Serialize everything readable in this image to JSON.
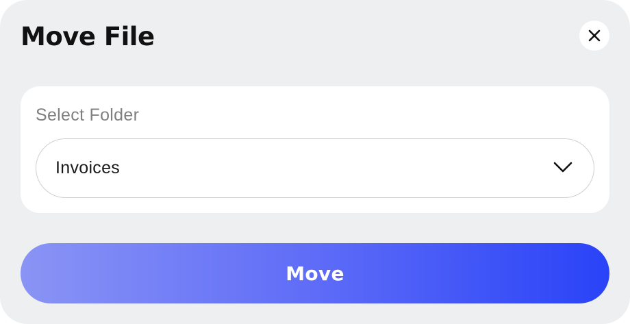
{
  "dialog": {
    "title": "Move File",
    "close_icon": "close-icon"
  },
  "folder_select": {
    "label": "Select Folder",
    "selected_value": "Invoices",
    "dropdown_icon": "chevron-down-icon"
  },
  "actions": {
    "move_label": "Move"
  },
  "colors": {
    "dialog_background": "#eeeff1",
    "card_background": "#ffffff",
    "button_gradient_start": "#8a94f5",
    "button_gradient_end": "#2943f7"
  }
}
